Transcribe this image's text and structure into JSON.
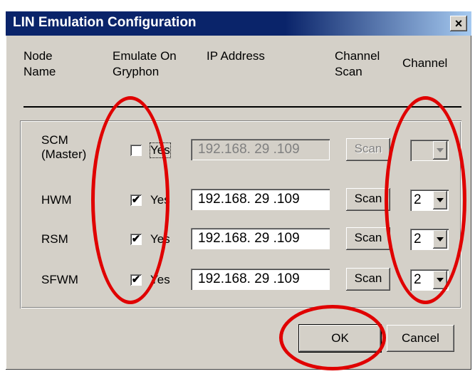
{
  "dialog": {
    "title": "LIN Emulation Configuration",
    "close_label": "×"
  },
  "headers": {
    "node_name": "Node\nName",
    "emulate_on": "Emulate On\nGryphon",
    "ip_address": "IP Address",
    "channel_scan": "Channel\nScan",
    "channel": "Channel"
  },
  "rows": [
    {
      "node": "SCM\n(Master)",
      "checked": false,
      "yes_label": "Yes",
      "ip": "192.168. 29 .109",
      "scan_label": "Scan",
      "channel": "",
      "enabled": false
    },
    {
      "node": "HWM",
      "checked": true,
      "yes_label": "Yes",
      "ip": "192.168. 29 .109",
      "scan_label": "Scan",
      "channel": "2",
      "enabled": true
    },
    {
      "node": "RSM",
      "checked": true,
      "yes_label": "Yes",
      "ip": "192.168. 29 .109",
      "scan_label": "Scan",
      "channel": "2",
      "enabled": true
    },
    {
      "node": "SFWM",
      "checked": true,
      "yes_label": "Yes",
      "ip": "192.168. 29 .109",
      "scan_label": "Scan",
      "channel": "2",
      "enabled": true
    }
  ],
  "buttons": {
    "ok": "OK",
    "cancel": "Cancel"
  },
  "check_glyph": "✔",
  "colors": {
    "annotation": "#e00000",
    "titlebar": "#0a246a"
  }
}
